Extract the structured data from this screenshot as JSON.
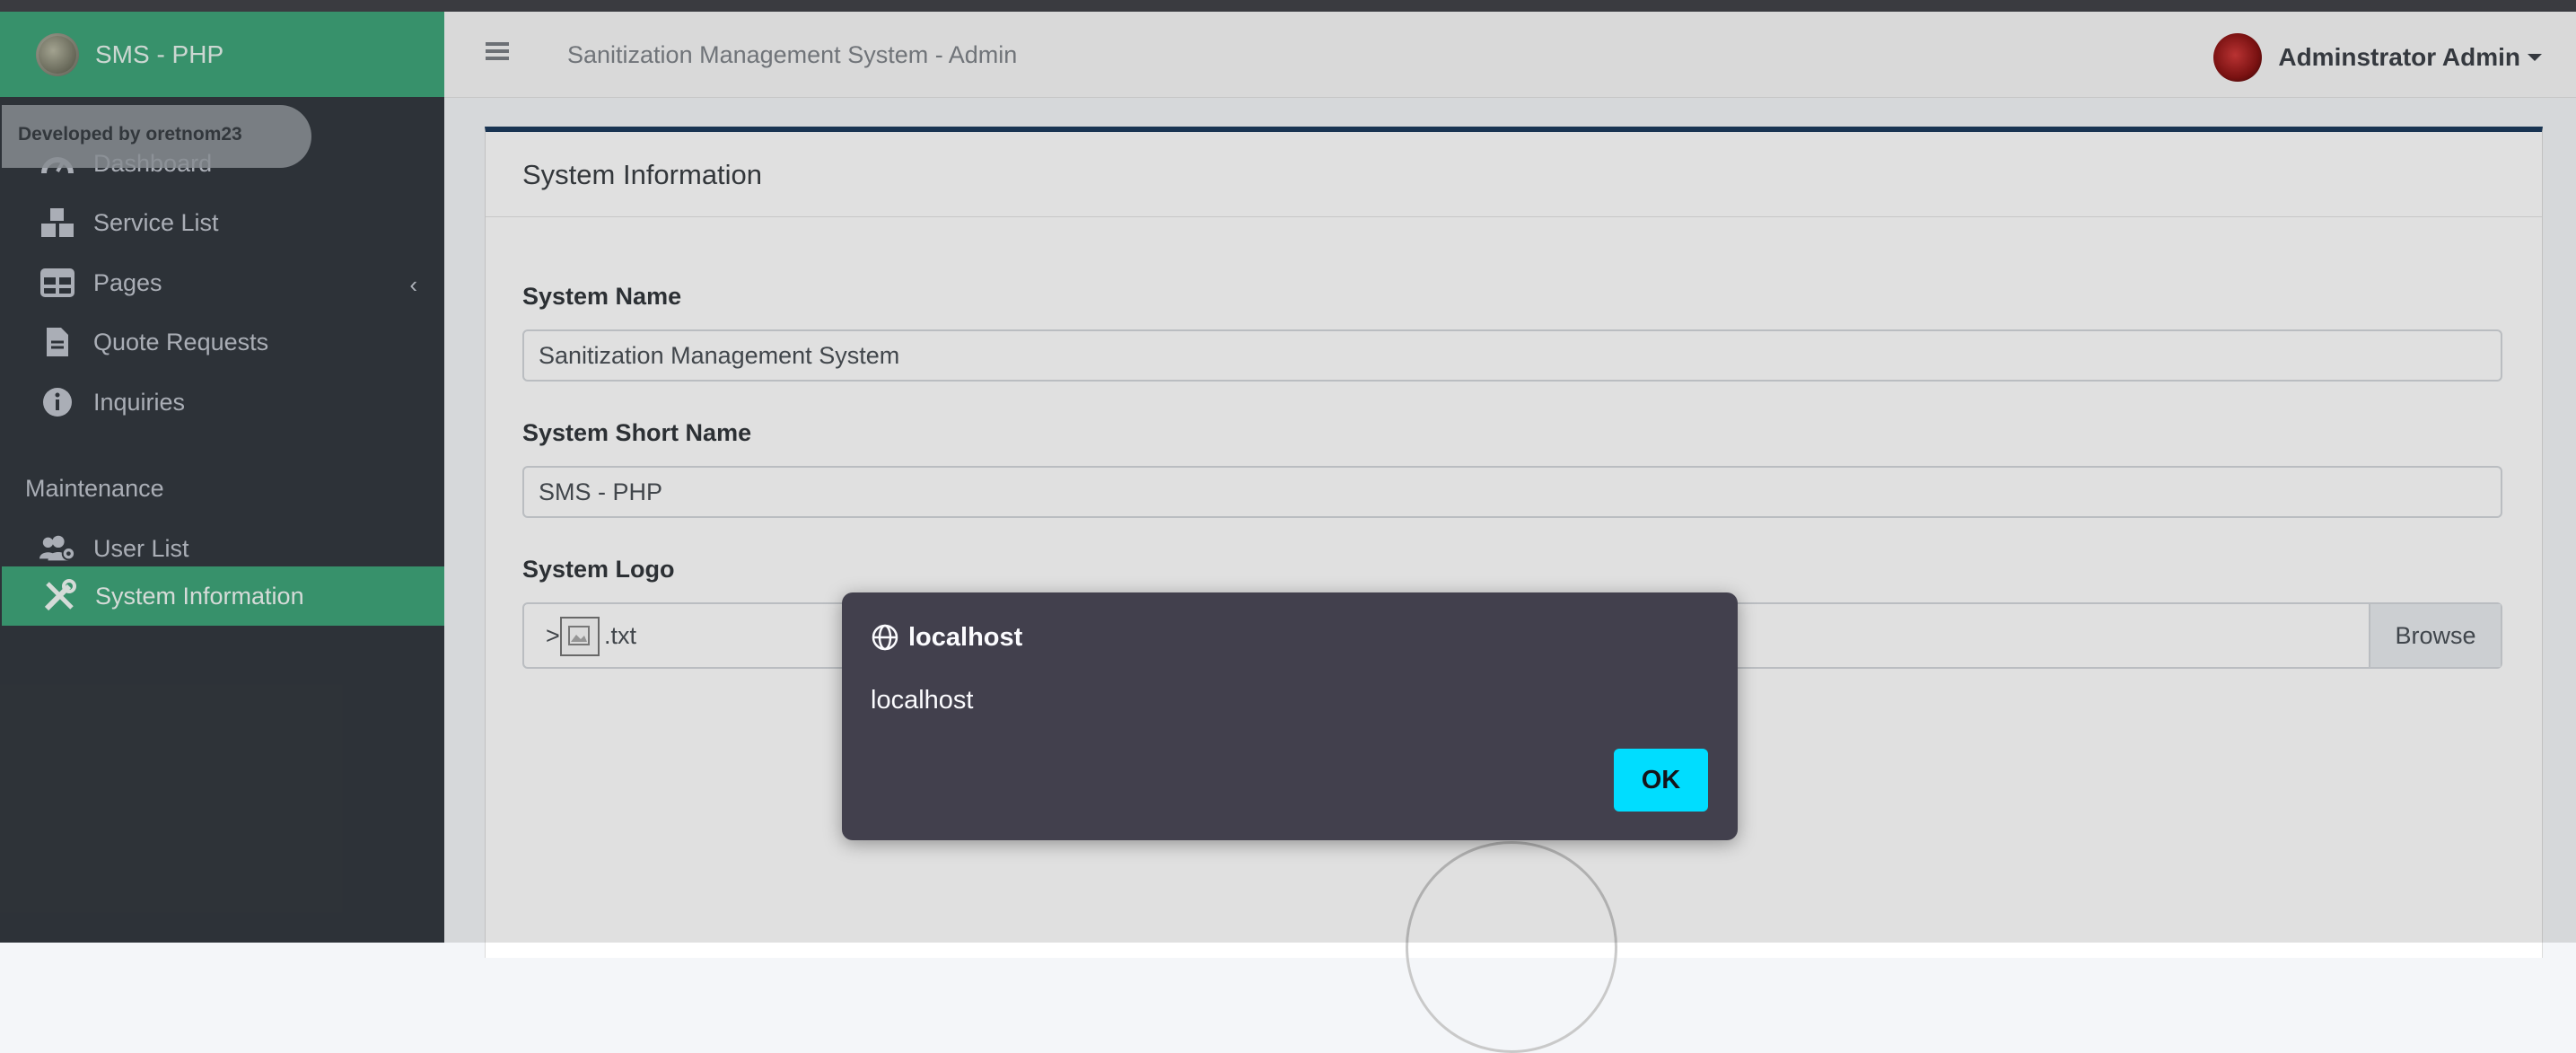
{
  "app": {
    "brand": "SMS - PHP",
    "developer_badge": "Developed by oretnom23"
  },
  "sidebar": {
    "items": [
      {
        "label": "Dashboard",
        "icon": "dashboard-icon"
      },
      {
        "label": "Service List",
        "icon": "boxes-icon"
      },
      {
        "label": "Pages",
        "icon": "table-icon"
      },
      {
        "label": "Quote Requests",
        "icon": "file-icon"
      },
      {
        "label": "Inquiries",
        "icon": "info-circle-icon"
      }
    ],
    "maintenance_header": "Maintenance",
    "maintenance_items": [
      {
        "label": "User List",
        "icon": "users-gear-icon"
      },
      {
        "label": "System Information",
        "icon": "tools-icon",
        "active": true
      }
    ]
  },
  "navbar": {
    "title": "Sanitization Management System - Admin",
    "user_name": "Adminstrator Admin"
  },
  "card": {
    "title": "System Information",
    "fields": {
      "system_name_label": "System Name",
      "system_name_value": "Sanitization Management System",
      "system_short_name_label": "System Short Name",
      "system_short_name_value": "SMS - PHP",
      "system_logo_label": "System Logo",
      "file_prefix": ">",
      "file_suffix": ".txt",
      "browse_label": "Browse"
    }
  },
  "dialog": {
    "title": "localhost",
    "message": "localhost",
    "ok_label": "OK"
  },
  "colors": {
    "sidebar_bg": "#343a40",
    "accent_green": "#3fa57a",
    "card_top_border": "#1d3c5e",
    "ok_button": "#00ddff",
    "dialog_bg": "#42404d"
  }
}
